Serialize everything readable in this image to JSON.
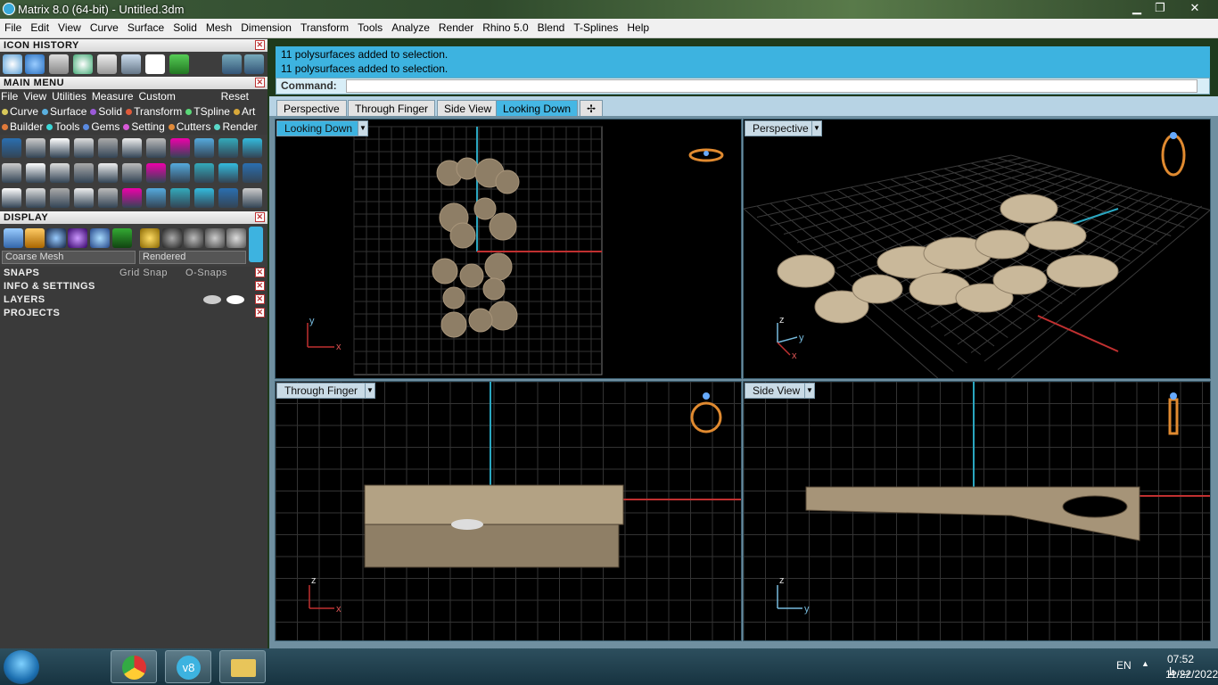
{
  "window": {
    "title": "Matrix 8.0 (64-bit) - Untitled.3dm",
    "minimize": "▁",
    "restore": "❐",
    "close": "✕"
  },
  "menubar": [
    "File",
    "Edit",
    "View",
    "Curve",
    "Surface",
    "Solid",
    "Mesh",
    "Dimension",
    "Transform",
    "Tools",
    "Analyze",
    "Render",
    "Rhino 5.0",
    "Blend",
    "T-Splines",
    "Help"
  ],
  "panels": {
    "icon_history": "ICON HISTORY",
    "main_menu": "MAIN MENU",
    "main_menu_row1": [
      "File",
      "View",
      "Utilities",
      "Measure",
      "Custom"
    ],
    "reset": "Reset",
    "main_menu_row2": [
      {
        "label": "Curve",
        "color": "#d8c85a"
      },
      {
        "label": "Surface",
        "color": "#5ab0e0"
      },
      {
        "label": "Solid",
        "color": "#9b5ad8"
      },
      {
        "label": "Transform",
        "color": "#e05a3a"
      },
      {
        "label": "TSpline",
        "color": "#5ad878"
      },
      {
        "label": "Art",
        "color": "#d8a83a"
      }
    ],
    "main_menu_row3": [
      {
        "label": "Builder",
        "color": "#e07a3a"
      },
      {
        "label": "Tools",
        "color": "#3ad8d8"
      },
      {
        "label": "Gems",
        "color": "#5a8ae0"
      },
      {
        "label": "Setting",
        "color": "#d85ad8"
      },
      {
        "label": "Cutters",
        "color": "#e08a3a"
      },
      {
        "label": "Render",
        "color": "#5ad8c8"
      }
    ],
    "display": "DISPLAY",
    "display_mesh": "Coarse Mesh",
    "display_mode": "Rendered",
    "snaps": "SNAPS",
    "grid_snap": "Grid Snap",
    "osnaps": "O-Snaps",
    "info": "INFO & SETTINGS",
    "layers": "LAYERS",
    "projects": "PROJECTS"
  },
  "command": {
    "history": [
      "11 polysurfaces added to selection.",
      "11 polysurfaces added to selection."
    ],
    "label": "Command:",
    "value": ""
  },
  "tabs": [
    {
      "label": "Perspective",
      "active": false
    },
    {
      "label": "Through Finger",
      "active": false
    },
    {
      "label": "Side View",
      "active": false
    },
    {
      "label": "Looking Down",
      "active": true
    }
  ],
  "viewports": {
    "top_left": {
      "label": "Looking Down",
      "axis_a": "y",
      "axis_b": "x"
    },
    "top_right": {
      "label": "Perspective",
      "axis_a": "z",
      "axis_b": "y",
      "axis_c": "x"
    },
    "bottom_left": {
      "label": "Through Finger",
      "axis_a": "z",
      "axis_b": "x"
    },
    "bottom_right": {
      "label": "Side View",
      "axis_a": "z",
      "axis_b": "y"
    }
  },
  "tray": {
    "lang": "EN",
    "time": "07:52 ب.ظ",
    "date": "11/22/2022"
  },
  "colors": {
    "accent": "#3db3e0",
    "grid": "#3a3a3a",
    "model": "#c9b89a"
  }
}
